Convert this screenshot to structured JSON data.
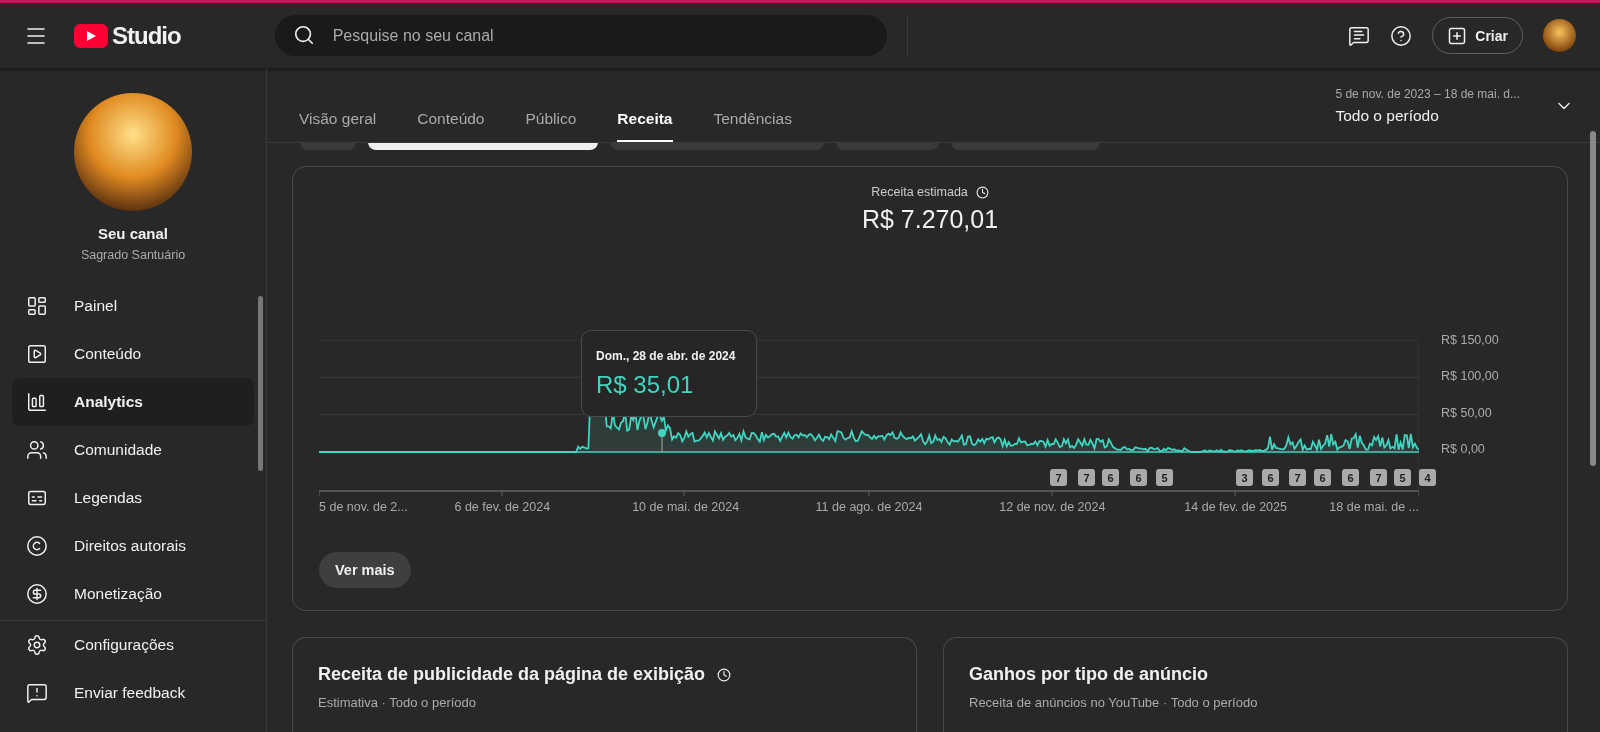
{
  "header": {
    "logo_text": "Studio",
    "search": {
      "placeholder": "Pesquise no seu canal"
    },
    "create_button": "Criar"
  },
  "sidebar": {
    "channel_title": "Seu canal",
    "channel_name": "Sagrado Santuário",
    "items": [
      {
        "kind": "dashboard",
        "label": "Painel",
        "selected": false
      },
      {
        "kind": "content",
        "label": "Conteúdo",
        "selected": false
      },
      {
        "kind": "analytics",
        "label": "Analytics",
        "selected": true
      },
      {
        "kind": "community",
        "label": "Comunidade",
        "selected": false
      },
      {
        "kind": "captions",
        "label": "Legendas",
        "selected": false
      },
      {
        "kind": "copyright",
        "label": "Direitos autorais",
        "selected": false
      },
      {
        "kind": "money",
        "label": "Monetização",
        "selected": false
      }
    ],
    "footer_items": [
      {
        "kind": "settings",
        "label": "Configurações"
      },
      {
        "kind": "feedback",
        "label": "Enviar feedback"
      }
    ]
  },
  "tabs": [
    {
      "label": "Visão geral",
      "selected": false
    },
    {
      "label": "Conteúdo",
      "selected": false
    },
    {
      "label": "Público",
      "selected": false
    },
    {
      "label": "Receita",
      "selected": true
    },
    {
      "label": "Tendências",
      "selected": false
    }
  ],
  "date_range": {
    "range": "5 de nov. de 2023 – 18 de mai. d...",
    "period": "Todo o período"
  },
  "filter_chips": [
    {
      "selected": false
    },
    {
      "selected": true
    },
    {
      "selected": false
    },
    {
      "selected": false
    },
    {
      "selected": false
    }
  ],
  "revenue_card": {
    "title": "Receita estimada",
    "value": "R$ 7.270,01",
    "y_labels": [
      "R$ 150,00",
      "R$ 100,00",
      "R$ 50,00",
      "R$ 0,00"
    ],
    "x_labels": [
      "5 de nov. de 2...",
      "6 de fev. de 2024",
      "10 de mai. de 2024",
      "11 de ago. de 2024",
      "12 de nov. de 2024",
      "14 de fev. de 2025",
      "18 de mai. de ..."
    ],
    "markers": [
      "7",
      "7",
      "6",
      "6",
      "5",
      "3",
      "6",
      "7",
      "6",
      "6",
      "7",
      "5",
      "4"
    ],
    "tooltip": {
      "date": "Dom., 28 de abr. de 2024",
      "value": "R$ 35,01"
    },
    "more_button": "Ver mais"
  },
  "cards": [
    {
      "title": "Receita de publicidade da página de exibição",
      "subtitle": "Estimativa · Todo o período",
      "info": true
    },
    {
      "title": "Ganhos por tipo de anúncio",
      "subtitle": "Receita de anúncios no YouTube · Todo o período",
      "info": false
    }
  ]
}
